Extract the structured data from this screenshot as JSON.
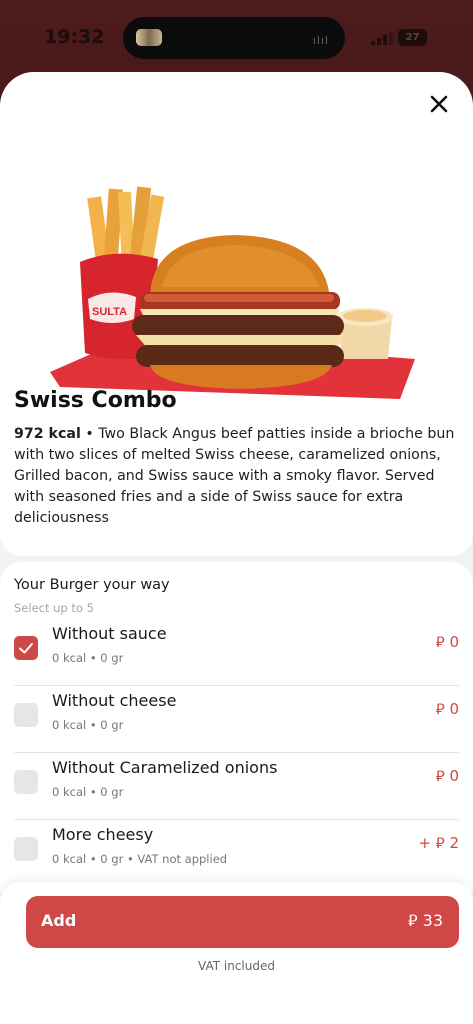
{
  "status_bar": {
    "time": "19:32",
    "battery": "27",
    "wave": "ılıl"
  },
  "product": {
    "title": "Swiss Combo",
    "kcal": "972 kcal",
    "bullet": " • ",
    "description": "Two Black Angus beef patties inside a brioche bun with two slices of melted Swiss cheese, caramelized onions, Grilled bacon, and Swiss sauce with a smoky flavor. Served with seasoned fries and a side of Swiss sauce for extra deliciousness",
    "image_icon": "burger-combo-image",
    "brand_on_box": "SULTA"
  },
  "options_group": {
    "title": "Your Burger your way",
    "subtitle": "Select up to 5",
    "options": [
      {
        "name": "Without sauce",
        "meta": "0 kcal • 0 gr",
        "price": "⃁ 0",
        "checked": true
      },
      {
        "name": "Without cheese",
        "meta": "0 kcal • 0 gr",
        "price": "⃁ 0",
        "checked": false
      },
      {
        "name": "Without Caramelized onions",
        "meta": "0 kcal • 0 gr",
        "price": "⃁ 0",
        "checked": false
      },
      {
        "name": "More cheesy",
        "meta": "0 kcal • 0 gr • VAT not applied",
        "price": "+ ⃁ 2",
        "checked": false
      }
    ]
  },
  "footer": {
    "add_label": "Add",
    "add_price": "⃁ 33",
    "vat_note": "VAT included"
  },
  "colors": {
    "accent": "#d04747",
    "background": "#4a1a1a"
  }
}
